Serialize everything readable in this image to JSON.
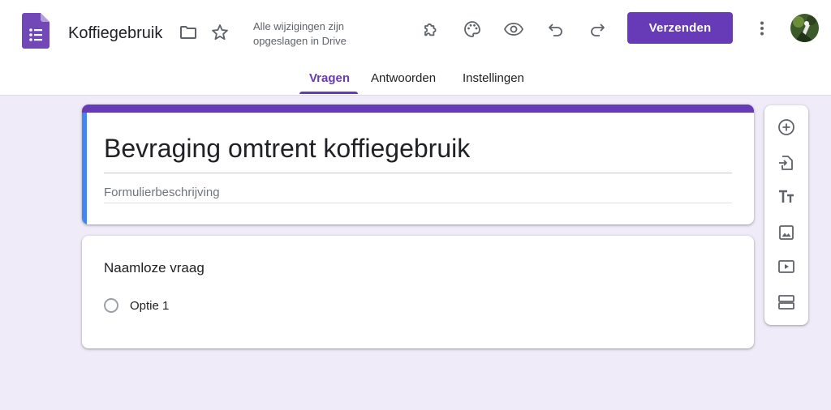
{
  "app": {
    "title": "Koffiegebruik",
    "save_status": "Alle wijzigingen zijn opgeslagen in Drive",
    "send_label": "Verzenden",
    "accent_color": "#673ab7",
    "icons": [
      "forms-app-icon",
      "folder-icon",
      "star-icon",
      "addons-icon",
      "palette-icon",
      "preview-eye-icon",
      "undo-icon",
      "redo-icon",
      "more-vert-icon",
      "avatar"
    ]
  },
  "tabs": [
    {
      "label": "Vragen",
      "active": true
    },
    {
      "label": "Antwoorden",
      "active": false
    },
    {
      "label": "Instellingen",
      "active": false
    }
  ],
  "form": {
    "title": "Bevraging omtrent koffiegebruik",
    "description_placeholder": "Formulierbeschrijving"
  },
  "question": {
    "title": "Naamloze vraag",
    "options": [
      "Optie 1"
    ]
  },
  "toolbar": {
    "icons": [
      "add-question-icon",
      "import-questions-icon",
      "add-title-icon",
      "add-image-icon",
      "add-video-icon",
      "add-section-icon"
    ]
  }
}
